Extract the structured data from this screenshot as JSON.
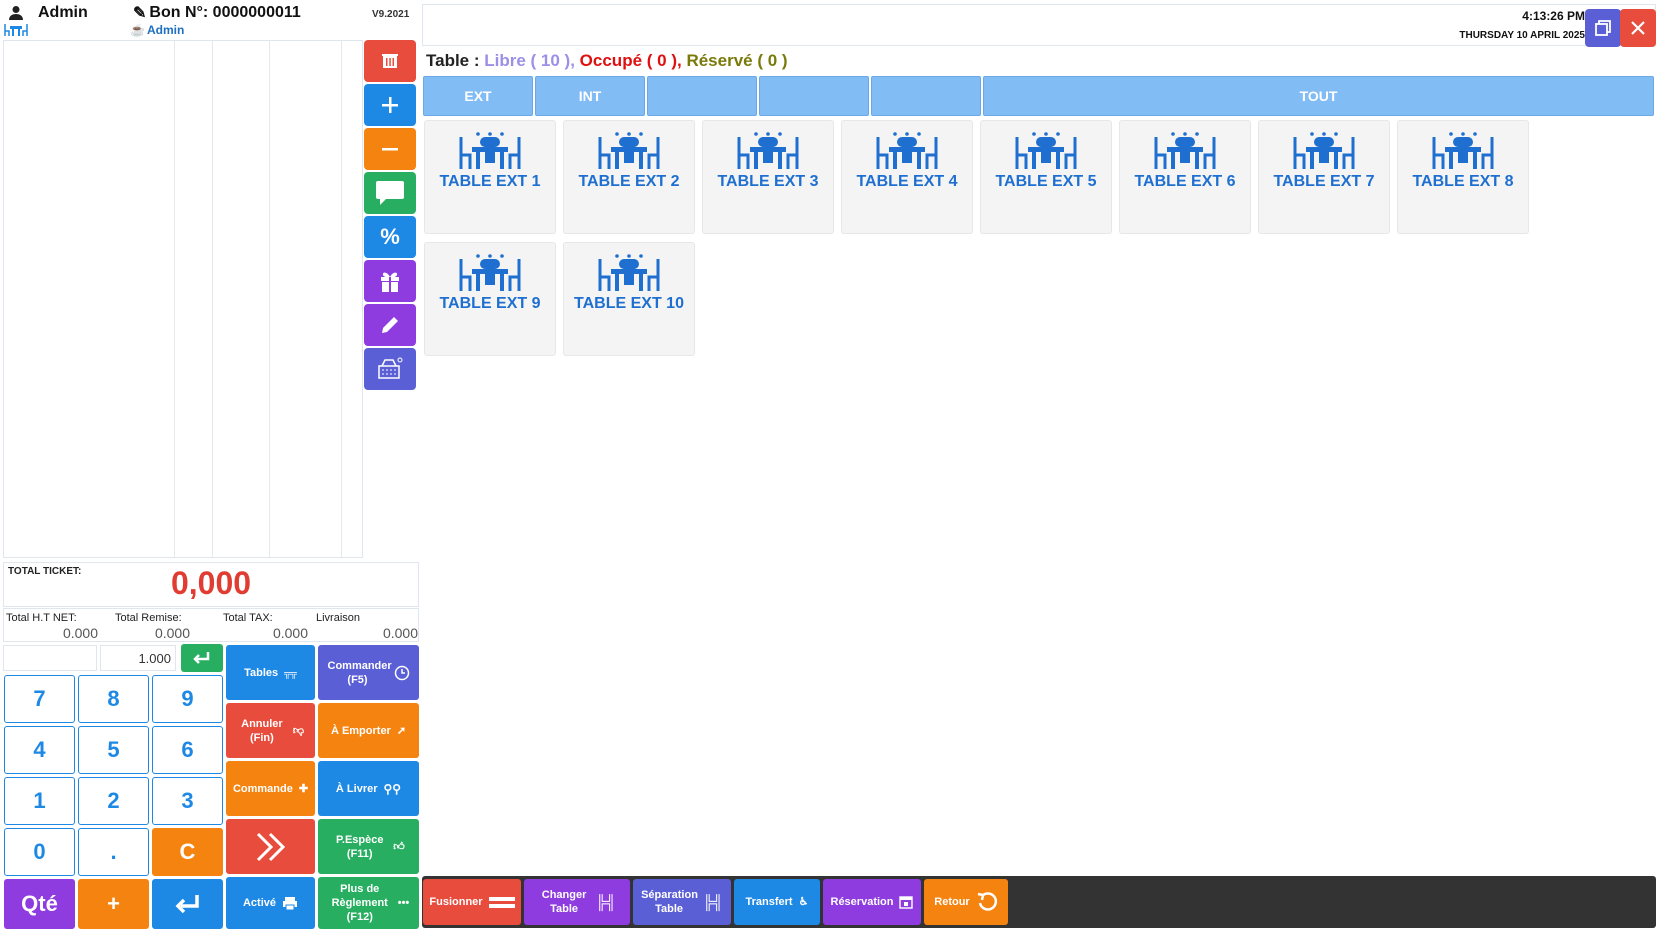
{
  "header": {
    "user": "Admin",
    "bon_label": "Bon N°: 0000000011",
    "sub_user": "Admin",
    "version": "V9.2021"
  },
  "totals": {
    "ticket_label": "TOTAL TICKET:",
    "ticket_value": "0,000",
    "ht_label": "Total H.T NET:",
    "ht_value": "0.000",
    "remise_label": "Total Remise:",
    "remise_value": "0.000",
    "tax_label": "Total TAX:",
    "tax_value": "0.000",
    "livraison_label": "Livraison",
    "livraison_value": "0.000"
  },
  "keypad": {
    "qty_value": "1.000",
    "keys": [
      "7",
      "8",
      "9",
      "4",
      "5",
      "6",
      "1",
      "2",
      "3",
      "0",
      ".",
      "C"
    ],
    "qte": "Qté",
    "plus": "+"
  },
  "functions": {
    "tables": "Tables",
    "commander": "Commander (F5)",
    "annuler": "Annuler (Fin)",
    "emporter": "À Emporter",
    "commande": "Commande",
    "livrer": "À Livrer",
    "pespece": "P.Espèce (F11)",
    "active": "Activé",
    "plus_reglement": "Plus de Règlement (F12)"
  },
  "right_header": {
    "time": "4:13:26 PM",
    "date": "THURSDAY 10 APRIL 2025"
  },
  "status": {
    "prefix": "Table : ",
    "libre": "Libre ( 10 ),",
    "occupe": "Occupé ( 0 ),",
    "reserve": "Réservé ( 0 )"
  },
  "tabs": [
    "EXT",
    "INT",
    "",
    "",
    "",
    "TOUT"
  ],
  "tables": [
    "TABLE EXT 1",
    "TABLE EXT 2",
    "TABLE EXT 3",
    "TABLE EXT 4",
    "TABLE EXT 5",
    "TABLE EXT 6",
    "TABLE EXT 7",
    "TABLE EXT 8",
    "TABLE EXT 9",
    "TABLE EXT 10"
  ],
  "bottom_actions": {
    "fusionner": "Fusionner",
    "changer": "Changer Table",
    "separation": "Séparation Table",
    "transfert": "Transfert",
    "reservation": "Réservation",
    "retour": "Retour"
  },
  "colors": {
    "red": "#e74c3c",
    "blue": "#1e88e5",
    "orange": "#f5830f",
    "green": "#27ae60",
    "purple": "#8e3bdf",
    "indigo": "#5b5fd6",
    "tab_blue": "#82bcf5",
    "libre": "#9b8fe8",
    "occupe": "#e01010",
    "reserve": "#7a7a0a"
  }
}
